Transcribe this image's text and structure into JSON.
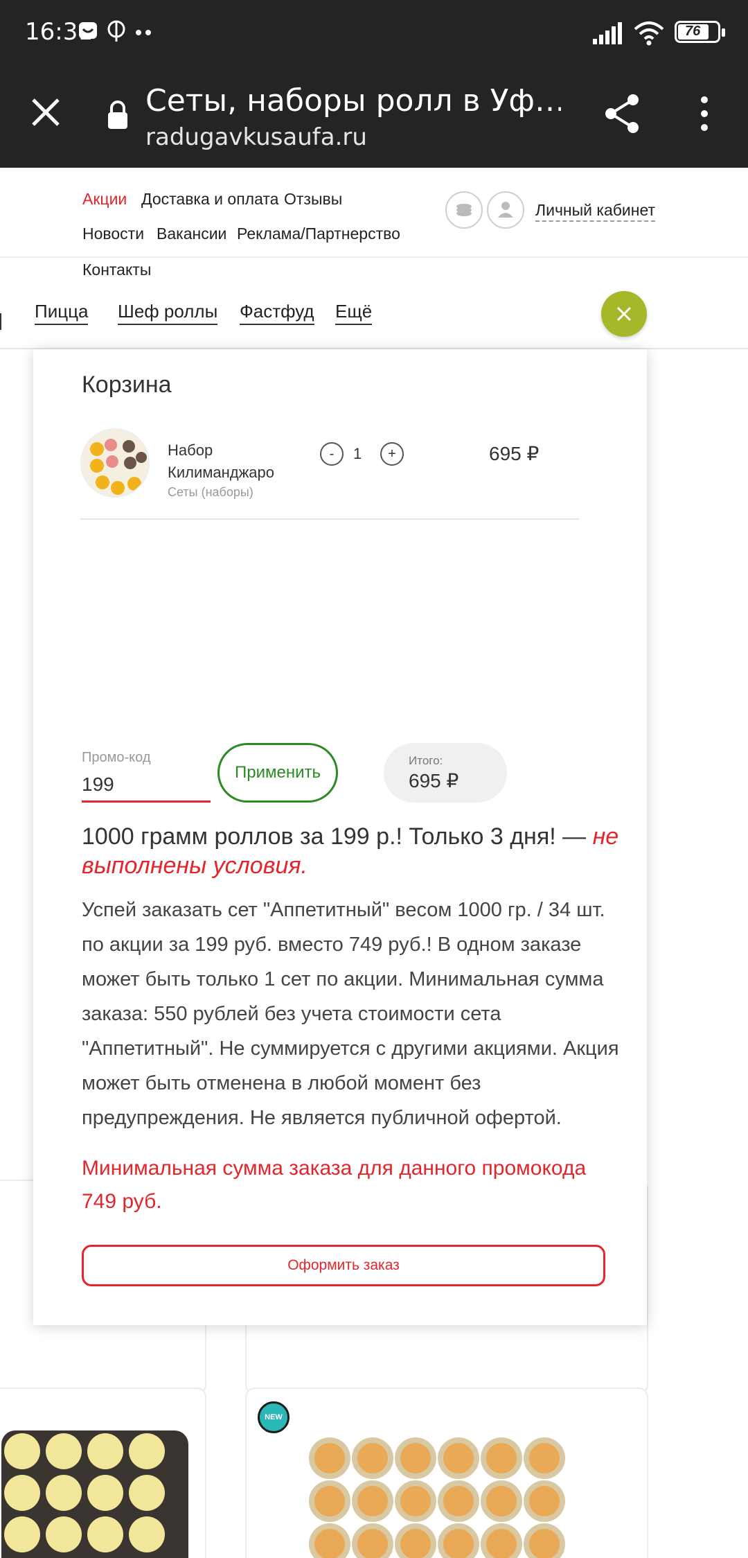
{
  "status_bar": {
    "time": "16:31",
    "battery": "76"
  },
  "browser": {
    "title": "Сеты, наборы ролл в Уф…",
    "url": "radugavkusaufa.ru"
  },
  "nav": {
    "links": [
      "Акции",
      "Доставка и оплата",
      "Отзывы",
      "Новости",
      "Вакансии",
      "Реклама/Партнерство",
      "Контакты"
    ],
    "account": "Личный кабинет"
  },
  "categories": [
    "Пицца",
    "Шеф роллы",
    "Фастфуд",
    "Ещё"
  ],
  "cart": {
    "title": "Корзина",
    "item": {
      "name": "Набор Килиманджаро",
      "category": "Сеты (наборы)",
      "quantity": "1",
      "price": "695 ₽",
      "minus": "-",
      "plus": "+"
    },
    "promo": {
      "label": "Промо-код",
      "value": "199",
      "apply": "Применить"
    },
    "total": {
      "label": "Итого:",
      "value": "695 ₽"
    },
    "promo_title": "1000 грамм роллов за 199 р.! Только 3 дня! —",
    "promo_status": "не выполнены условия.",
    "promo_description": "Успей заказать сет \"Аппетитный\" весом 1000 гр. / 34 шт. по акции за 199 руб. вместо 749 руб.! В одном заказе может быть только 1 сет по акции. Минимальная сумма заказа: 550 рублей без учета стоимости сета \"Аппетитный\". Не суммируется с другими акциями. Акция может быть отменена в любой момент без предупреждения. Не является публичной офертой.",
    "min_sum_warning": "Минимальная сумма заказа для данного промокода 749 руб.",
    "checkout": "Оформить заказ"
  },
  "badge": "NEW",
  "colors": {
    "accent_red": "#e2262b",
    "accent_green": "#2a8a23",
    "close_btn": "#a7b72a"
  }
}
